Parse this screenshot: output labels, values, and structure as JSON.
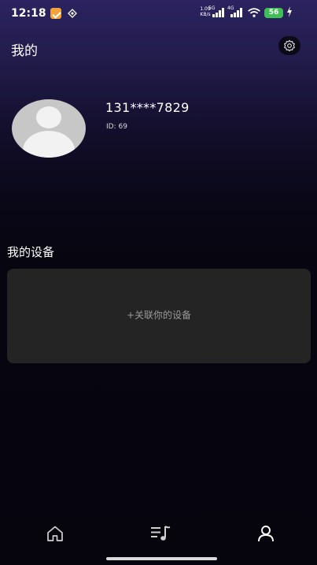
{
  "status_bar": {
    "time": "12:18",
    "net_speed_value": "1.09",
    "net_speed_unit": "KB/s",
    "network_1": "5G",
    "network_2": "4G",
    "battery": "56",
    "icons": [
      "notification-app-icon",
      "notification-app-icon-2",
      "signal-icon",
      "signal-icon",
      "wifi-icon",
      "battery-icon",
      "charging-icon"
    ],
    "battery_color": "#3fbf55"
  },
  "header": {
    "title": "我的",
    "settings_icon": "gear-icon"
  },
  "profile": {
    "phone": "131****7829",
    "user_id": "ID: 69",
    "avatar_icon": "default-avatar"
  },
  "devices": {
    "section_title": "我的设备",
    "link_label": "+关联你的设备"
  },
  "bottom_nav": {
    "items": [
      {
        "icon": "home-icon"
      },
      {
        "icon": "music-list-icon"
      },
      {
        "icon": "user-icon",
        "active": true
      }
    ]
  },
  "colors": {
    "background_top": "#2c2360",
    "background_bottom": "#06040d",
    "card": "#242424",
    "muted_text": "#9a9a9a"
  }
}
